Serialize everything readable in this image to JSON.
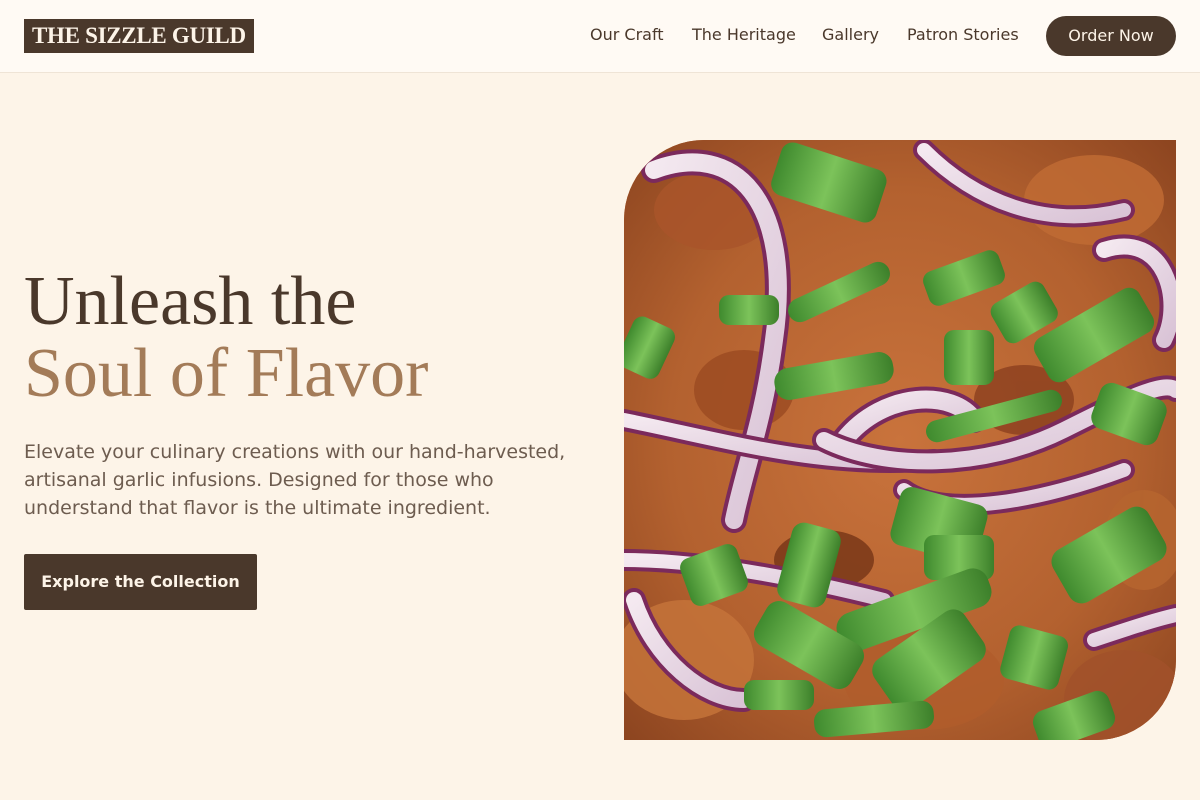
{
  "brand": {
    "name": "THE SIZZLE GUILD"
  },
  "nav": {
    "links": [
      "Our Craft",
      "The Heritage",
      "Gallery",
      "Patron Stories"
    ],
    "order_label": "Order Now"
  },
  "hero": {
    "headline_line1": "Unleash the",
    "headline_line2": "Soul of Flavor",
    "description": "Elevate your culinary creations with our hand-harvested, artisanal garlic infusions. Designed for those who understand that flavor is the ultimate ingredient.",
    "cta_label": "Explore the Collection",
    "image_subject": "close-up of dish topped with sliced red onion and green onion"
  },
  "colors": {
    "background": "#fdf4e8",
    "header_bg": "#fffaf4",
    "primary_dark": "#4a382b",
    "accent": "#a37b58",
    "body_text": "#6d5c4f"
  }
}
